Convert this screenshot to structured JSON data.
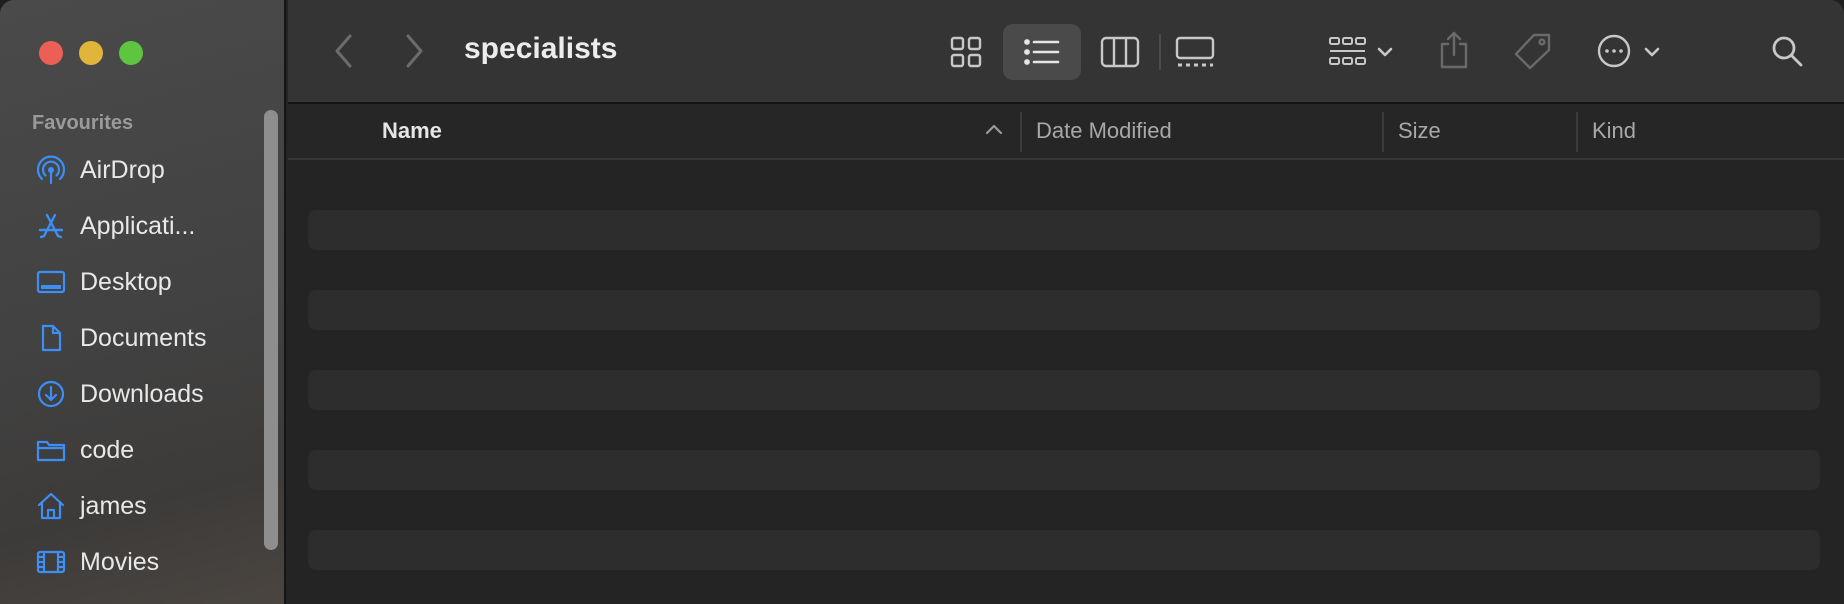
{
  "window": {
    "title": "specialists"
  },
  "sidebar": {
    "heading": "Favourites",
    "items": [
      {
        "label": "AirDrop",
        "icon": "airdrop-icon"
      },
      {
        "label": "Applicati...",
        "icon": "applications-icon"
      },
      {
        "label": "Desktop",
        "icon": "desktop-icon"
      },
      {
        "label": "Documents",
        "icon": "document-icon"
      },
      {
        "label": "Downloads",
        "icon": "download-icon"
      },
      {
        "label": "code",
        "icon": "folder-icon"
      },
      {
        "label": "james",
        "icon": "home-icon"
      },
      {
        "label": "Movies",
        "icon": "film-icon"
      }
    ]
  },
  "toolbar": {
    "view_selected": "list"
  },
  "columns": {
    "name": "Name",
    "date_modified": "Date Modified",
    "size": "Size",
    "kind": "Kind"
  },
  "colors": {
    "accent": "#3b8ff6",
    "sidebar_text": "#e8e8e8",
    "close": "#ec5f57",
    "minimize": "#e1b43a",
    "zoom": "#5fc440"
  }
}
